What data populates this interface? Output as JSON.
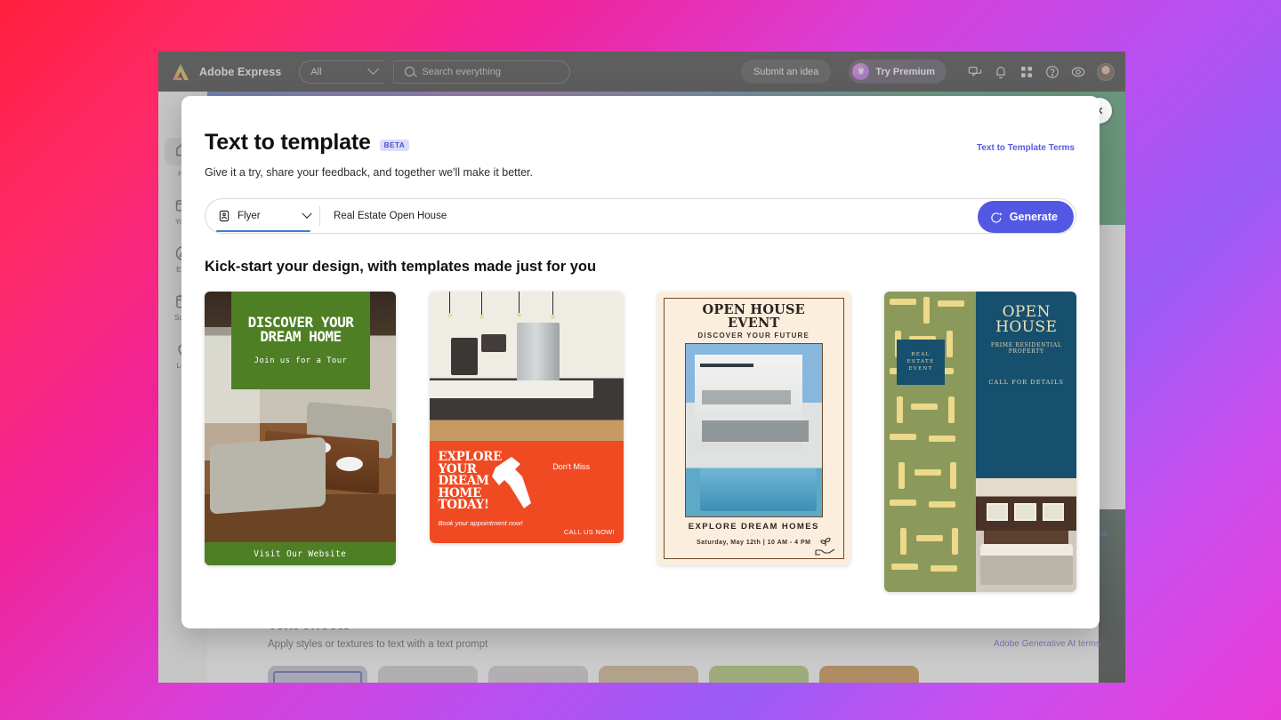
{
  "topnav": {
    "brand": "Adobe Express",
    "logo_icon": "adobe-logo-icon",
    "filter_label": "All",
    "filter_chevron_icon": "chevron-down-icon",
    "search_placeholder": "Search everything",
    "search_icon": "search-icon",
    "submit_idea_label": "Submit an idea",
    "try_premium_label": "Try Premium",
    "premium_icon": "crown-icon",
    "icons": [
      "chat-icon",
      "bell-icon",
      "apps-grid-icon",
      "help-icon",
      "creative-cloud-icon"
    ],
    "avatar": "user-avatar"
  },
  "sidebar": {
    "items": [
      {
        "label": "Ho",
        "icon": "home-icon",
        "active": true
      },
      {
        "label": "Your",
        "icon": "folder-icon",
        "active": false
      },
      {
        "label": "Exp",
        "icon": "compass-icon",
        "active": false
      },
      {
        "label": "Sche",
        "icon": "calendar-icon",
        "active": false
      },
      {
        "label": "Lea",
        "icon": "lightbulb-icon",
        "active": false
      }
    ]
  },
  "background": {
    "text_effects_title": "Text effects",
    "text_effects_sub": "Apply styles or textures to text with a text prompt",
    "generative_terms": "Adobe Generative AI terms",
    "right_label": "rms",
    "swatch_colors": [
      "#aab0cc",
      "#c0c0c0",
      "#c9bccd",
      "#c8a473",
      "#9cbb4f",
      "#c2731a"
    ]
  },
  "modal": {
    "close_icon": "close-icon",
    "title": "Text to template",
    "badge": "BETA",
    "terms_link": "Text to Template Terms",
    "subtitle": "Give it a try, share your feedback, and together we'll make it better.",
    "prompt": {
      "type_icon": "flyer-icon",
      "type_value": "Flyer",
      "type_chevron_icon": "chevron-down-icon",
      "prompt_value": "Real Estate Open House",
      "generate_label": "Generate",
      "generate_icon": "sparkle-wand-icon",
      "accent_color": "#5258e4",
      "underline_color": "#3a7fd5"
    },
    "section_title": "Kick-start your design, with templates made just for you",
    "templates": [
      {
        "name": "discover-your-dream-home",
        "headline_line1": "DISCOVER YOUR",
        "headline_line2": "DREAM HOME",
        "subhead": "Join us for a Tour",
        "footer": "Visit Our Website",
        "accent": "#4e7f25"
      },
      {
        "name": "explore-your-dream-home-today",
        "headline": "EXPLORE\nYOUR\nDREAM\nHOME\nTODAY!",
        "note": "Book your appointment now!",
        "badge": "Don't Miss",
        "cta": "CALL US NOW!",
        "accent": "#f04a23"
      },
      {
        "name": "open-house-event",
        "title_line1": "OPEN HOUSE",
        "title_line2": "EVENT",
        "subtitle": "DISCOVER YOUR FUTURE",
        "footer_title": "EXPLORE DREAM HOMES",
        "footer_detail": "Saturday, May 12th | 10 AM - 4 PM",
        "accent": "#fbeedd"
      },
      {
        "name": "open-house-prime-residential",
        "title_line1": "OPEN",
        "title_line2": "HOUSE",
        "subtitle": "PRIME RESIDENTIAL PROPERTY",
        "cta": "CALL FOR DETAILS",
        "tag_line1": "REAL",
        "tag_line2": "ESTATE",
        "tag_line3": "EVENT",
        "accent": "#17506e"
      }
    ]
  }
}
